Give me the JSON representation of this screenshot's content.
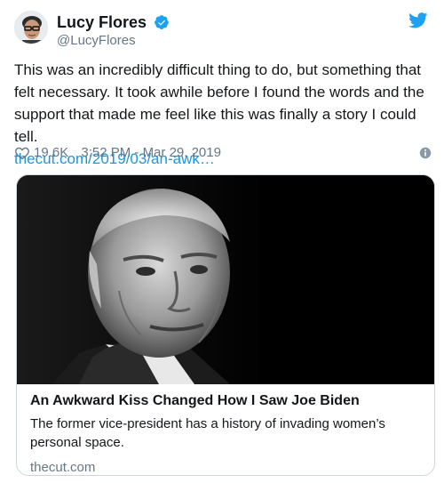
{
  "user": {
    "display_name": "Lucy Flores",
    "handle": "@LucyFlores",
    "verified": true
  },
  "tweet": {
    "text": "This was an incredibly difficult thing to do, but something that felt necessary. It took awhile before I found the words and the support that made me feel like this was finally a story I could tell.",
    "link": "thecut.com/2019/03/an-awk…",
    "like_count": "19.6K",
    "timestamp": "3:52 PM - Mar 29, 2019"
  },
  "card": {
    "title": "An Awkward Kiss Changed How I Saw Joe Biden",
    "description": "The former vice-president has a history of invading women’s personal space.",
    "domain": "thecut.com"
  },
  "colors": {
    "link": "#1b95e0",
    "verified": "#1da1f2",
    "secondary_text": "#657786",
    "border": "#ccd6dd"
  },
  "icons": {
    "verified": "verified-badge-icon",
    "brand": "twitter-bird-icon",
    "like": "heart-icon",
    "info": "info-icon"
  }
}
